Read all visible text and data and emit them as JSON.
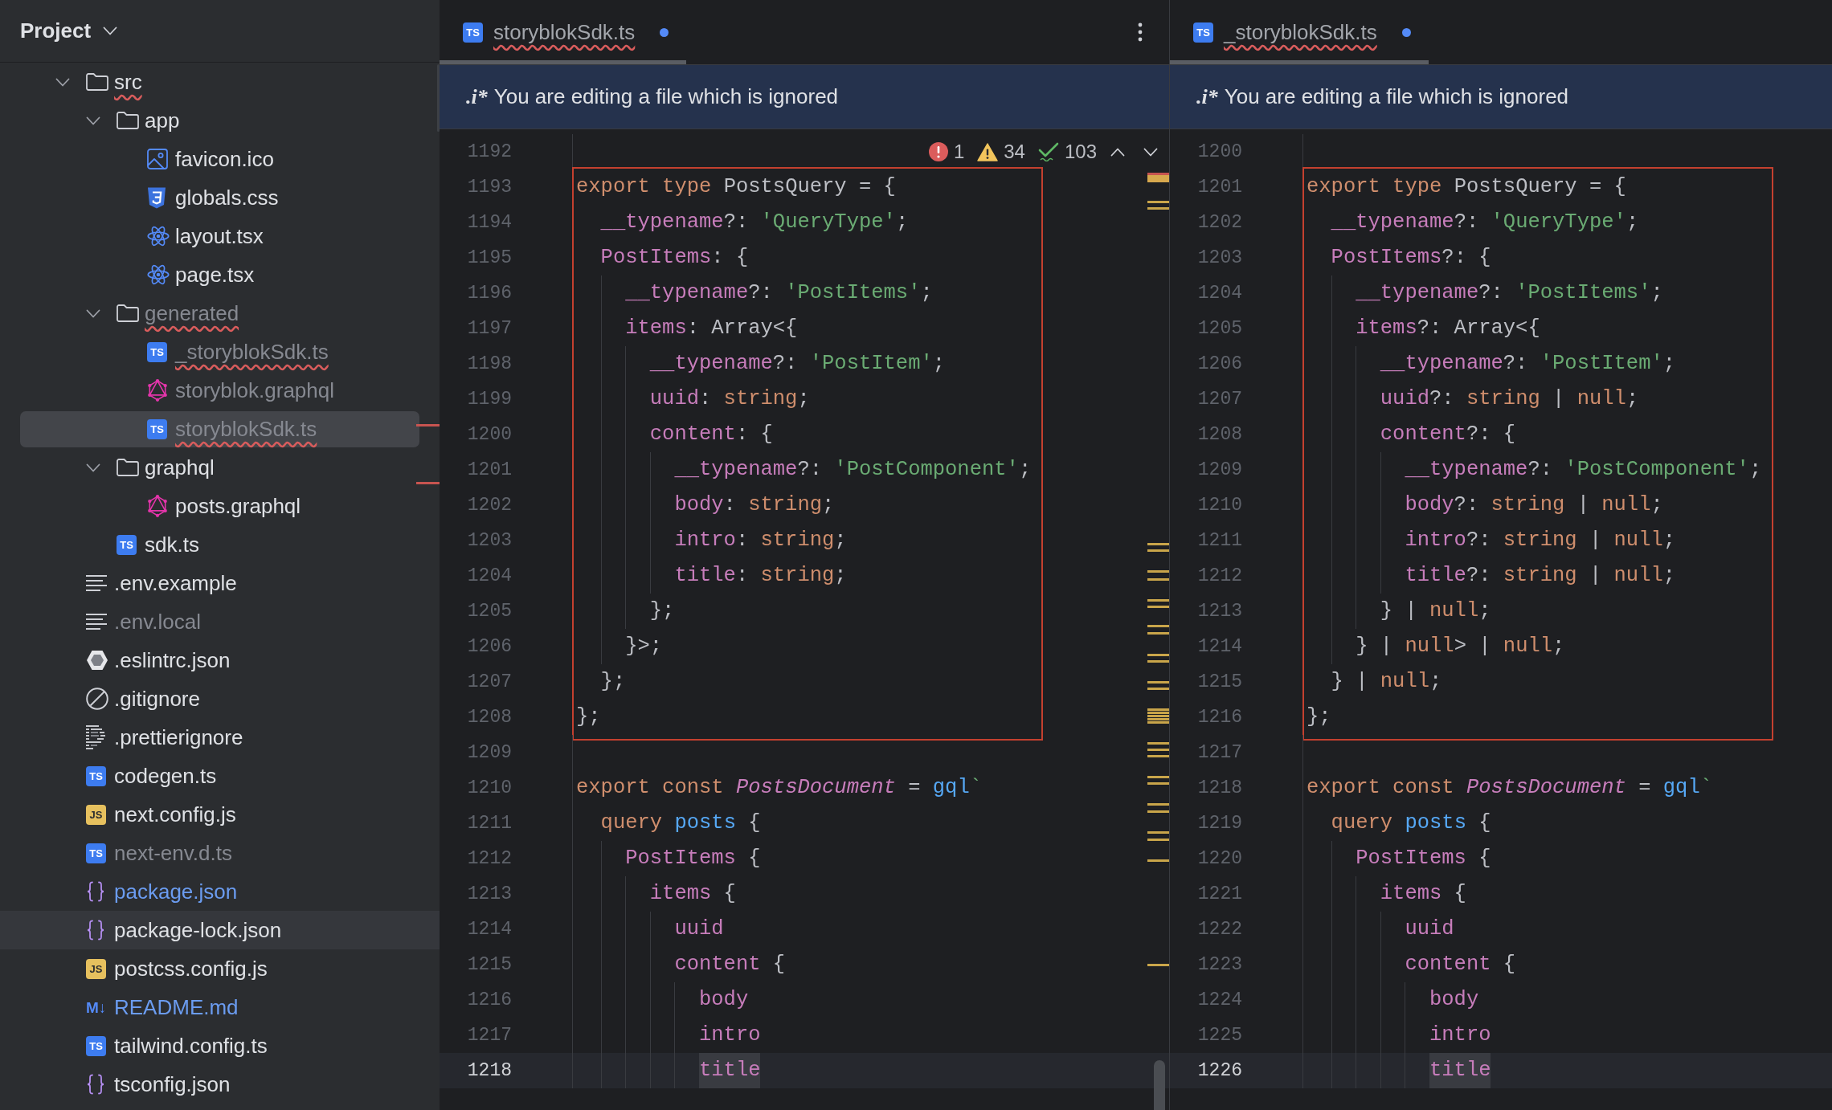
{
  "sidebar": {
    "title": "Project",
    "tree": [
      {
        "name": "src",
        "kind": "folder",
        "ignored": false,
        "modified": false,
        "squiggle": true,
        "selected": false,
        "hovered": false,
        "expanded": true,
        "children": [
          {
            "name": "app",
            "kind": "folder",
            "ignored": false,
            "modified": false,
            "squiggle": false,
            "selected": false,
            "hovered": false,
            "expanded": true,
            "children": [
              {
                "name": "favicon.ico",
                "kind": "image",
                "ignored": false,
                "modified": false,
                "squiggle": false,
                "selected": false,
                "hovered": false
              },
              {
                "name": "globals.css",
                "kind": "css",
                "ignored": false,
                "modified": false,
                "squiggle": false,
                "selected": false,
                "hovered": false
              },
              {
                "name": "layout.tsx",
                "kind": "react",
                "ignored": false,
                "modified": false,
                "squiggle": false,
                "selected": false,
                "hovered": false
              },
              {
                "name": "page.tsx",
                "kind": "react",
                "ignored": false,
                "modified": false,
                "squiggle": false,
                "selected": false,
                "hovered": false
              }
            ]
          },
          {
            "name": "generated",
            "kind": "folder",
            "ignored": true,
            "modified": false,
            "squiggle": true,
            "selected": false,
            "hovered": false,
            "expanded": true,
            "children": [
              {
                "name": "_storyblokSdk.ts",
                "kind": "ts",
                "badge": "TS",
                "ignored": true,
                "modified": false,
                "squiggle": true,
                "selected": false,
                "hovered": false
              },
              {
                "name": "storyblok.graphql",
                "kind": "graphql",
                "ignored": true,
                "modified": false,
                "squiggle": false,
                "selected": false,
                "hovered": false
              },
              {
                "name": "storyblokSdk.ts",
                "kind": "ts",
                "badge": "TS",
                "ignored": true,
                "modified": false,
                "squiggle": true,
                "selected": true,
                "hovered": false
              }
            ]
          },
          {
            "name": "graphql",
            "kind": "folder",
            "ignored": false,
            "modified": false,
            "squiggle": false,
            "selected": false,
            "hovered": false,
            "expanded": true,
            "children": [
              {
                "name": "posts.graphql",
                "kind": "graphql",
                "ignored": false,
                "modified": false,
                "squiggle": false,
                "selected": false,
                "hovered": false
              }
            ]
          },
          {
            "name": "sdk.ts",
            "kind": "ts",
            "badge": "TS",
            "ignored": false,
            "modified": false,
            "squiggle": false,
            "selected": false,
            "hovered": false
          }
        ]
      },
      {
        "name": ".env.example",
        "kind": "text",
        "ignored": false,
        "modified": false,
        "squiggle": false,
        "selected": false,
        "hovered": false
      },
      {
        "name": ".env.local",
        "kind": "text",
        "ignored": true,
        "modified": false,
        "squiggle": false,
        "selected": false,
        "hovered": false
      },
      {
        "name": ".eslintrc.json",
        "kind": "eslint",
        "ignored": false,
        "modified": false,
        "squiggle": false,
        "selected": false,
        "hovered": false
      },
      {
        "name": ".gitignore",
        "kind": "gitignore",
        "ignored": false,
        "modified": false,
        "squiggle": false,
        "selected": false,
        "hovered": false
      },
      {
        "name": ".prettierignore",
        "kind": "prettier",
        "ignored": false,
        "modified": false,
        "squiggle": false,
        "selected": false,
        "hovered": false
      },
      {
        "name": "codegen.ts",
        "kind": "ts",
        "badge": "TS",
        "ignored": false,
        "modified": false,
        "squiggle": false,
        "selected": false,
        "hovered": false
      },
      {
        "name": "next.config.js",
        "kind": "js",
        "badge": "JS",
        "ignored": false,
        "modified": false,
        "squiggle": false,
        "selected": false,
        "hovered": false
      },
      {
        "name": "next-env.d.ts",
        "kind": "ts",
        "badge": "TS",
        "ignored": true,
        "modified": false,
        "squiggle": false,
        "selected": false,
        "hovered": false
      },
      {
        "name": "package.json",
        "kind": "json",
        "ignored": false,
        "modified": true,
        "squiggle": false,
        "selected": false,
        "hovered": false
      },
      {
        "name": "package-lock.json",
        "kind": "json",
        "ignored": false,
        "modified": false,
        "squiggle": false,
        "selected": false,
        "hovered": true
      },
      {
        "name": "postcss.config.js",
        "kind": "js",
        "badge": "JS",
        "ignored": false,
        "modified": false,
        "squiggle": false,
        "selected": false,
        "hovered": false
      },
      {
        "name": "README.md",
        "kind": "markdown",
        "badge": "M↓",
        "ignored": false,
        "modified": true,
        "squiggle": false,
        "selected": false,
        "hovered": false
      },
      {
        "name": "tailwind.config.ts",
        "kind": "ts",
        "badge": "TS",
        "ignored": false,
        "modified": false,
        "squiggle": false,
        "selected": false,
        "hovered": false
      },
      {
        "name": "tsconfig.json",
        "kind": "json",
        "ignored": false,
        "modified": false,
        "squiggle": false,
        "selected": false,
        "hovered": false
      }
    ]
  },
  "editors": [
    {
      "tabs": [
        {
          "badge": "TS",
          "label": "storyblokSdk.ts",
          "ignored": true,
          "squiggle": true,
          "selected": true,
          "modified": true
        }
      ],
      "more_menu": true,
      "banner": {
        "icon": ".i*",
        "text": "You are editing a file which is ignored"
      },
      "inspections": [
        {
          "kind": "error",
          "count": "1"
        },
        {
          "kind": "warning",
          "count": "34"
        },
        {
          "kind": "ok",
          "count": "103"
        }
      ],
      "segments": [
        {
          "boxed": false,
          "lines": [
            {
              "number": "1192",
              "current": false
            }
          ]
        },
        {
          "boxed": true,
          "lines": [
            {
              "number": "1193",
              "current": false,
              "tokens": [
                {
                  "kind": "keyword",
                  "text": "export type"
                },
                {
                  "kind": "plain",
                  "text": " PostsQuery = {"
                }
              ]
            },
            {
              "number": "1194",
              "current": false,
              "tokens": [
                {
                  "kind": "property",
                  "text": "  __typename"
                },
                {
                  "kind": "plain",
                  "text": "?: "
                },
                {
                  "kind": "string",
                  "text": "'QueryType'"
                },
                {
                  "kind": "plain",
                  "text": ";"
                }
              ]
            },
            {
              "number": "1195",
              "current": false,
              "tokens": [
                {
                  "kind": "property",
                  "text": "  PostItems"
                },
                {
                  "kind": "plain",
                  "text": ": {"
                }
              ]
            },
            {
              "number": "1196",
              "current": false,
              "tokens": [
                {
                  "kind": "property",
                  "text": "    __typename"
                },
                {
                  "kind": "plain",
                  "text": "?: "
                },
                {
                  "kind": "string",
                  "text": "'PostItems'"
                },
                {
                  "kind": "plain",
                  "text": ";"
                }
              ]
            },
            {
              "number": "1197",
              "current": false,
              "tokens": [
                {
                  "kind": "property",
                  "text": "    items"
                },
                {
                  "kind": "plain",
                  "text": ": Array<{"
                }
              ]
            },
            {
              "number": "1198",
              "current": false,
              "tokens": [
                {
                  "kind": "property",
                  "text": "      __typename"
                },
                {
                  "kind": "plain",
                  "text": "?: "
                },
                {
                  "kind": "string",
                  "text": "'PostItem'"
                },
                {
                  "kind": "plain",
                  "text": ";"
                }
              ]
            },
            {
              "number": "1199",
              "current": false,
              "tokens": [
                {
                  "kind": "property",
                  "text": "      uuid"
                },
                {
                  "kind": "plain",
                  "text": ": "
                },
                {
                  "kind": "keyword",
                  "text": "string"
                },
                {
                  "kind": "plain",
                  "text": ";"
                }
              ]
            },
            {
              "number": "1200",
              "current": false,
              "tokens": [
                {
                  "kind": "property",
                  "text": "      content"
                },
                {
                  "kind": "plain",
                  "text": ": {"
                }
              ]
            },
            {
              "number": "1201",
              "current": false,
              "tokens": [
                {
                  "kind": "property",
                  "text": "        __typename"
                },
                {
                  "kind": "plain",
                  "text": "?: "
                },
                {
                  "kind": "string",
                  "text": "'PostComponent'"
                },
                {
                  "kind": "plain",
                  "text": ";"
                }
              ]
            },
            {
              "number": "1202",
              "current": false,
              "tokens": [
                {
                  "kind": "property",
                  "text": "        body"
                },
                {
                  "kind": "plain",
                  "text": ": "
                },
                {
                  "kind": "keyword",
                  "text": "string"
                },
                {
                  "kind": "plain",
                  "text": ";"
                }
              ]
            },
            {
              "number": "1203",
              "current": false,
              "tokens": [
                {
                  "kind": "property",
                  "text": "        intro"
                },
                {
                  "kind": "plain",
                  "text": ": "
                },
                {
                  "kind": "keyword",
                  "text": "string"
                },
                {
                  "kind": "plain",
                  "text": ";"
                }
              ]
            },
            {
              "number": "1204",
              "current": false,
              "tokens": [
                {
                  "kind": "property",
                  "text": "        title"
                },
                {
                  "kind": "plain",
                  "text": ": "
                },
                {
                  "kind": "keyword",
                  "text": "string"
                },
                {
                  "kind": "plain",
                  "text": ";"
                }
              ]
            },
            {
              "number": "1205",
              "current": false,
              "tokens": [
                {
                  "kind": "plain",
                  "text": "      };"
                }
              ]
            },
            {
              "number": "1206",
              "current": false,
              "tokens": [
                {
                  "kind": "plain",
                  "text": "    }>;"
                }
              ]
            },
            {
              "number": "1207",
              "current": false,
              "tokens": [
                {
                  "kind": "plain",
                  "text": "  };"
                }
              ]
            },
            {
              "number": "1208",
              "current": false,
              "tokens": [
                {
                  "kind": "plain",
                  "text": "};"
                }
              ]
            }
          ]
        },
        {
          "boxed": false,
          "lines": [
            {
              "number": "1209",
              "current": false
            },
            {
              "number": "1210",
              "current": false,
              "tokens": [
                {
                  "kind": "keyword",
                  "text": "export const "
                },
                {
                  "kind": "italic",
                  "text": "PostsDocument"
                },
                {
                  "kind": "plain",
                  "text": " = "
                },
                {
                  "kind": "function",
                  "text": "gql"
                },
                {
                  "kind": "string",
                  "text": "`"
                }
              ]
            },
            {
              "number": "1211",
              "current": false,
              "tokens": [
                {
                  "kind": "keyword",
                  "text": "  query "
                },
                {
                  "kind": "function",
                  "text": "posts"
                },
                {
                  "kind": "plain",
                  "text": " {"
                }
              ]
            },
            {
              "number": "1212",
              "current": false,
              "tokens": [
                {
                  "kind": "property",
                  "text": "    PostItems"
                },
                {
                  "kind": "plain",
                  "text": " {"
                }
              ]
            },
            {
              "number": "1213",
              "current": false,
              "tokens": [
                {
                  "kind": "property",
                  "text": "      items"
                },
                {
                  "kind": "plain",
                  "text": " {"
                }
              ]
            },
            {
              "number": "1214",
              "current": false,
              "tokens": [
                {
                  "kind": "property",
                  "text": "        uuid"
                }
              ]
            },
            {
              "number": "1215",
              "current": false,
              "tokens": [
                {
                  "kind": "property",
                  "text": "        content"
                },
                {
                  "kind": "plain",
                  "text": " {"
                }
              ]
            },
            {
              "number": "1216",
              "current": false,
              "tokens": [
                {
                  "kind": "property",
                  "text": "          body"
                }
              ]
            },
            {
              "number": "1217",
              "current": false,
              "tokens": [
                {
                  "kind": "property",
                  "text": "          intro"
                }
              ]
            },
            {
              "number": "1218",
              "current": true,
              "tokens": [
                {
                  "kind": "occurrence",
                  "text": "          title"
                }
              ]
            }
          ]
        }
      ]
    },
    {
      "tabs": [
        {
          "badge": "TS",
          "label": "_storyblokSdk.ts",
          "ignored": true,
          "squiggle": true,
          "selected": true,
          "modified": true
        }
      ],
      "banner": {
        "icon": ".i*",
        "text": "You are editing a file which is ignored"
      },
      "segments": [
        {
          "boxed": false,
          "lines": [
            {
              "number": "1200",
              "current": false
            }
          ]
        },
        {
          "boxed": true,
          "lines": [
            {
              "number": "1201",
              "current": false,
              "tokens": [
                {
                  "kind": "keyword",
                  "text": "export type"
                },
                {
                  "kind": "plain",
                  "text": " PostsQuery = {"
                }
              ]
            },
            {
              "number": "1202",
              "current": false,
              "tokens": [
                {
                  "kind": "property",
                  "text": "  __typename"
                },
                {
                  "kind": "plain",
                  "text": "?: "
                },
                {
                  "kind": "string",
                  "text": "'QueryType'"
                },
                {
                  "kind": "plain",
                  "text": ";"
                }
              ]
            },
            {
              "number": "1203",
              "current": false,
              "tokens": [
                {
                  "kind": "property",
                  "text": "  PostItems"
                },
                {
                  "kind": "plain",
                  "text": "?: {"
                }
              ]
            },
            {
              "number": "1204",
              "current": false,
              "tokens": [
                {
                  "kind": "property",
                  "text": "    __typename"
                },
                {
                  "kind": "plain",
                  "text": "?: "
                },
                {
                  "kind": "string",
                  "text": "'PostItems'"
                },
                {
                  "kind": "plain",
                  "text": ";"
                }
              ]
            },
            {
              "number": "1205",
              "current": false,
              "tokens": [
                {
                  "kind": "property",
                  "text": "    items"
                },
                {
                  "kind": "plain",
                  "text": "?: Array<{"
                }
              ]
            },
            {
              "number": "1206",
              "current": false,
              "tokens": [
                {
                  "kind": "property",
                  "text": "      __typename"
                },
                {
                  "kind": "plain",
                  "text": "?: "
                },
                {
                  "kind": "string",
                  "text": "'PostItem'"
                },
                {
                  "kind": "plain",
                  "text": ";"
                }
              ]
            },
            {
              "number": "1207",
              "current": false,
              "tokens": [
                {
                  "kind": "property",
                  "text": "      uuid"
                },
                {
                  "kind": "plain",
                  "text": "?: "
                },
                {
                  "kind": "keyword",
                  "text": "string"
                },
                {
                  "kind": "plain",
                  "text": " | "
                },
                {
                  "kind": "keyword",
                  "text": "null"
                },
                {
                  "kind": "plain",
                  "text": ";"
                }
              ]
            },
            {
              "number": "1208",
              "current": false,
              "tokens": [
                {
                  "kind": "property",
                  "text": "      content"
                },
                {
                  "kind": "plain",
                  "text": "?: {"
                }
              ]
            },
            {
              "number": "1209",
              "current": false,
              "tokens": [
                {
                  "kind": "property",
                  "text": "        __typename"
                },
                {
                  "kind": "plain",
                  "text": "?: "
                },
                {
                  "kind": "string",
                  "text": "'PostComponent'"
                },
                {
                  "kind": "plain",
                  "text": ";"
                }
              ]
            },
            {
              "number": "1210",
              "current": false,
              "tokens": [
                {
                  "kind": "property",
                  "text": "        body"
                },
                {
                  "kind": "plain",
                  "text": "?: "
                },
                {
                  "kind": "keyword",
                  "text": "string"
                },
                {
                  "kind": "plain",
                  "text": " | "
                },
                {
                  "kind": "keyword",
                  "text": "null"
                },
                {
                  "kind": "plain",
                  "text": ";"
                }
              ]
            },
            {
              "number": "1211",
              "current": false,
              "tokens": [
                {
                  "kind": "property",
                  "text": "        intro"
                },
                {
                  "kind": "plain",
                  "text": "?: "
                },
                {
                  "kind": "keyword",
                  "text": "string"
                },
                {
                  "kind": "plain",
                  "text": " | "
                },
                {
                  "kind": "keyword",
                  "text": "null"
                },
                {
                  "kind": "plain",
                  "text": ";"
                }
              ]
            },
            {
              "number": "1212",
              "current": false,
              "tokens": [
                {
                  "kind": "property",
                  "text": "        title"
                },
                {
                  "kind": "plain",
                  "text": "?: "
                },
                {
                  "kind": "keyword",
                  "text": "string"
                },
                {
                  "kind": "plain",
                  "text": " | "
                },
                {
                  "kind": "keyword",
                  "text": "null"
                },
                {
                  "kind": "plain",
                  "text": ";"
                }
              ]
            },
            {
              "number": "1213",
              "current": false,
              "tokens": [
                {
                  "kind": "plain",
                  "text": "      } | "
                },
                {
                  "kind": "keyword",
                  "text": "null"
                },
                {
                  "kind": "plain",
                  "text": ";"
                }
              ]
            },
            {
              "number": "1214",
              "current": false,
              "tokens": [
                {
                  "kind": "plain",
                  "text": "    } | "
                },
                {
                  "kind": "keyword",
                  "text": "null"
                },
                {
                  "kind": "plain",
                  "text": "> | "
                },
                {
                  "kind": "keyword",
                  "text": "null"
                },
                {
                  "kind": "plain",
                  "text": ";"
                }
              ]
            },
            {
              "number": "1215",
              "current": false,
              "tokens": [
                {
                  "kind": "plain",
                  "text": "  } | "
                },
                {
                  "kind": "keyword",
                  "text": "null"
                },
                {
                  "kind": "plain",
                  "text": ";"
                }
              ]
            },
            {
              "number": "1216",
              "current": false,
              "tokens": [
                {
                  "kind": "plain",
                  "text": "};"
                }
              ]
            }
          ]
        },
        {
          "boxed": false,
          "lines": [
            {
              "number": "1217",
              "current": false
            },
            {
              "number": "1218",
              "current": false,
              "tokens": [
                {
                  "kind": "keyword",
                  "text": "export const "
                },
                {
                  "kind": "italic",
                  "text": "PostsDocument"
                },
                {
                  "kind": "plain",
                  "text": " = "
                },
                {
                  "kind": "function",
                  "text": "gql"
                },
                {
                  "kind": "string",
                  "text": "`"
                }
              ]
            },
            {
              "number": "1219",
              "current": false,
              "tokens": [
                {
                  "kind": "keyword",
                  "text": "  query "
                },
                {
                  "kind": "function",
                  "text": "posts"
                },
                {
                  "kind": "plain",
                  "text": " {"
                }
              ]
            },
            {
              "number": "1220",
              "current": false,
              "tokens": [
                {
                  "kind": "property",
                  "text": "    PostItems"
                },
                {
                  "kind": "plain",
                  "text": " {"
                }
              ]
            },
            {
              "number": "1221",
              "current": false,
              "tokens": [
                {
                  "kind": "property",
                  "text": "      items"
                },
                {
                  "kind": "plain",
                  "text": " {"
                }
              ]
            },
            {
              "number": "1222",
              "current": false,
              "tokens": [
                {
                  "kind": "property",
                  "text": "        uuid"
                }
              ]
            },
            {
              "number": "1223",
              "current": false,
              "tokens": [
                {
                  "kind": "property",
                  "text": "        content"
                },
                {
                  "kind": "plain",
                  "text": " {"
                }
              ]
            },
            {
              "number": "1224",
              "current": false,
              "tokens": [
                {
                  "kind": "property",
                  "text": "          body"
                }
              ]
            },
            {
              "number": "1225",
              "current": false,
              "tokens": [
                {
                  "kind": "property",
                  "text": "          intro"
                }
              ]
            },
            {
              "number": "1226",
              "current": true,
              "tokens": [
                {
                  "kind": "occurrence",
                  "text": "          title"
                }
              ]
            }
          ]
        }
      ]
    }
  ]
}
